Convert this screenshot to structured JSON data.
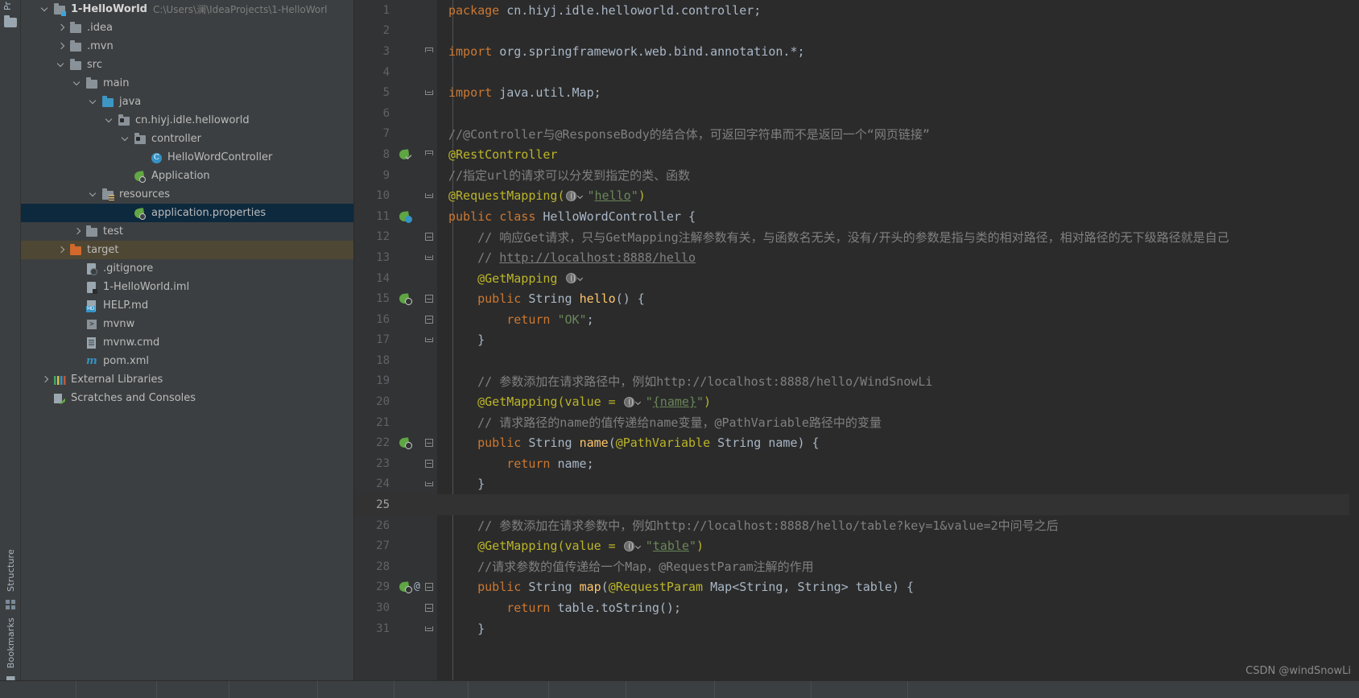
{
  "rail": {
    "top_label": "Pr",
    "project_icon": "folder-icon",
    "structure_label": "Structure",
    "bookmarks_label": "Bookmarks"
  },
  "project_tree": {
    "items": [
      {
        "label": "1-HelloWorld",
        "path": "C:\\Users\\澜\\IdeaProjects\\1-HelloWorl",
        "icon": "module-folder-icon",
        "indent": 0,
        "arrow": "open",
        "bold": true,
        "state": "normal"
      },
      {
        "label": ".idea",
        "path": "",
        "icon": "folder-icon",
        "indent": 1,
        "arrow": "closed",
        "bold": false,
        "state": "normal"
      },
      {
        "label": ".mvn",
        "path": "",
        "icon": "folder-icon",
        "indent": 1,
        "arrow": "closed",
        "bold": false,
        "state": "normal"
      },
      {
        "label": "src",
        "path": "",
        "icon": "folder-icon",
        "indent": 1,
        "arrow": "open",
        "bold": false,
        "state": "normal"
      },
      {
        "label": "main",
        "path": "",
        "icon": "folder-icon",
        "indent": 2,
        "arrow": "open",
        "bold": false,
        "state": "normal"
      },
      {
        "label": "java",
        "path": "",
        "icon": "source-folder-icon",
        "indent": 3,
        "arrow": "open",
        "bold": false,
        "state": "normal"
      },
      {
        "label": "cn.hiyj.idle.helloworld",
        "path": "",
        "icon": "package-icon",
        "indent": 4,
        "arrow": "open",
        "bold": false,
        "state": "normal"
      },
      {
        "label": "controller",
        "path": "",
        "icon": "package-icon",
        "indent": 5,
        "arrow": "open",
        "bold": false,
        "state": "normal"
      },
      {
        "label": "HelloWordController",
        "path": "",
        "icon": "java-class-icon",
        "indent": 6,
        "arrow": "none",
        "bold": false,
        "state": "normal"
      },
      {
        "label": "Application",
        "path": "",
        "icon": "spring-boot-class-icon",
        "indent": 5,
        "arrow": "none",
        "bold": false,
        "state": "normal"
      },
      {
        "label": "resources",
        "path": "",
        "icon": "resources-folder-icon",
        "indent": 3,
        "arrow": "open",
        "bold": false,
        "state": "normal"
      },
      {
        "label": "application.properties",
        "path": "",
        "icon": "spring-properties-icon",
        "indent": 5,
        "arrow": "none",
        "bold": false,
        "state": "selected"
      },
      {
        "label": "test",
        "path": "",
        "icon": "folder-icon",
        "indent": 2,
        "arrow": "closed",
        "bold": false,
        "state": "normal"
      },
      {
        "label": "target",
        "path": "",
        "icon": "excluded-folder-icon",
        "indent": 1,
        "arrow": "closed",
        "bold": false,
        "state": "excluded"
      },
      {
        "label": ".gitignore",
        "path": "",
        "icon": "gitignore-file-icon",
        "indent": 2,
        "arrow": "none",
        "bold": false,
        "state": "normal"
      },
      {
        "label": "1-HelloWorld.iml",
        "path": "",
        "icon": "iml-file-icon",
        "indent": 2,
        "arrow": "none",
        "bold": false,
        "state": "normal"
      },
      {
        "label": "HELP.md",
        "path": "",
        "icon": "markdown-file-icon",
        "indent": 2,
        "arrow": "none",
        "bold": false,
        "state": "normal"
      },
      {
        "label": "mvnw",
        "path": "",
        "icon": "shell-script-icon",
        "indent": 2,
        "arrow": "none",
        "bold": false,
        "state": "normal"
      },
      {
        "label": "mvnw.cmd",
        "path": "",
        "icon": "cmd-file-icon",
        "indent": 2,
        "arrow": "none",
        "bold": false,
        "state": "normal"
      },
      {
        "label": "pom.xml",
        "path": "",
        "icon": "maven-pom-icon",
        "indent": 2,
        "arrow": "none",
        "bold": false,
        "state": "normal"
      },
      {
        "label": "External Libraries",
        "path": "",
        "icon": "libraries-icon",
        "indent": 0,
        "arrow": "closed",
        "bold": false,
        "state": "normal"
      },
      {
        "label": "Scratches and Consoles",
        "path": "",
        "icon": "scratches-icon",
        "indent": 0,
        "arrow": "none",
        "bold": false,
        "state": "normal"
      }
    ]
  },
  "editor": {
    "caret_line": 25,
    "lines": [
      {
        "no": 1,
        "marker": "",
        "fold": "",
        "tokens": [
          {
            "t": "kw",
            "v": "package"
          },
          {
            "t": "plain",
            "v": " "
          },
          {
            "t": "cls",
            "v": "cn.hiyj.idle.helloworld.controller"
          },
          {
            "t": "punct",
            "v": ";"
          }
        ]
      },
      {
        "no": 2,
        "marker": "",
        "fold": "",
        "tokens": []
      },
      {
        "no": 3,
        "marker": "",
        "fold": "top-cap",
        "tokens": [
          {
            "t": "kw",
            "v": "import"
          },
          {
            "t": "plain",
            "v": " "
          },
          {
            "t": "cls",
            "v": "org.springframework.web.bind.annotation.*"
          },
          {
            "t": "punct",
            "v": ";"
          }
        ]
      },
      {
        "no": 4,
        "marker": "",
        "fold": "",
        "tokens": []
      },
      {
        "no": 5,
        "marker": "",
        "fold": "bot-cap",
        "tokens": [
          {
            "t": "kw",
            "v": "import"
          },
          {
            "t": "plain",
            "v": " "
          },
          {
            "t": "cls",
            "v": "java.util.Map"
          },
          {
            "t": "punct",
            "v": ";"
          }
        ]
      },
      {
        "no": 6,
        "marker": "",
        "fold": "",
        "tokens": []
      },
      {
        "no": 7,
        "marker": "",
        "fold": "",
        "tokens": [
          {
            "t": "cmt",
            "v": "//@Controller与@ResponseBody的结合体，可返回字符串而不是返回一个“网页链接”"
          }
        ]
      },
      {
        "no": 8,
        "marker": "spring-check",
        "fold": "top-cap",
        "tokens": [
          {
            "t": "ann",
            "v": "@RestController"
          }
        ]
      },
      {
        "no": 9,
        "marker": "",
        "fold": "",
        "tokens": [
          {
            "t": "cmt",
            "v": "//指定url的请求可以分发到指定的类、函数"
          }
        ]
      },
      {
        "no": 10,
        "marker": "",
        "fold": "bot-cap",
        "tokens": [
          {
            "t": "ann",
            "v": "@RequestMapping("
          },
          {
            "t": "urlicon",
            "v": ""
          },
          {
            "t": "str",
            "v": "\""
          },
          {
            "t": "link",
            "v": "hello"
          },
          {
            "t": "str",
            "v": "\""
          },
          {
            "t": "ann",
            "v": ")"
          }
        ]
      },
      {
        "no": 11,
        "marker": "spring-blue",
        "fold": "",
        "tokens": [
          {
            "t": "kw",
            "v": "public"
          },
          {
            "t": "plain",
            "v": " "
          },
          {
            "t": "kw",
            "v": "class"
          },
          {
            "t": "plain",
            "v": " "
          },
          {
            "t": "cls",
            "v": "HelloWordController"
          },
          {
            "t": "plain",
            "v": " "
          },
          {
            "t": "punct",
            "v": "{"
          }
        ]
      },
      {
        "no": 12,
        "marker": "",
        "fold": "box",
        "tokens": [
          {
            "t": "indent",
            "v": "    "
          },
          {
            "t": "cmt",
            "v": "// 响应Get请求，只与GetMapping注解参数有关，与函数名无关，没有/开头的参数是指与类的相对路径，相对路径的无下级路径就是自己"
          }
        ]
      },
      {
        "no": 13,
        "marker": "",
        "fold": "bot-cap",
        "tokens": [
          {
            "t": "indent",
            "v": "    "
          },
          {
            "t": "cmt",
            "v": "// "
          },
          {
            "t": "cmtlink",
            "v": "http://localhost:8888/hello"
          }
        ]
      },
      {
        "no": 14,
        "marker": "",
        "fold": "",
        "tokens": [
          {
            "t": "indent",
            "v": "    "
          },
          {
            "t": "ann",
            "v": "@GetMapping"
          },
          {
            "t": "plain",
            "v": " "
          },
          {
            "t": "urlicon",
            "v": ""
          }
        ]
      },
      {
        "no": 15,
        "marker": "spring",
        "fold": "box",
        "tokens": [
          {
            "t": "indent",
            "v": "    "
          },
          {
            "t": "kw",
            "v": "public"
          },
          {
            "t": "plain",
            "v": " "
          },
          {
            "t": "cls",
            "v": "String"
          },
          {
            "t": "plain",
            "v": " "
          },
          {
            "t": "fn",
            "v": "hello"
          },
          {
            "t": "punct",
            "v": "() {"
          }
        ]
      },
      {
        "no": 16,
        "marker": "",
        "fold": "box",
        "tokens": [
          {
            "t": "indent",
            "v": "        "
          },
          {
            "t": "kw",
            "v": "return"
          },
          {
            "t": "plain",
            "v": " "
          },
          {
            "t": "str",
            "v": "\"OK\""
          },
          {
            "t": "punct",
            "v": ";"
          }
        ]
      },
      {
        "no": 17,
        "marker": "",
        "fold": "bot-cap",
        "tokens": [
          {
            "t": "indent",
            "v": "    "
          },
          {
            "t": "punct",
            "v": "}"
          }
        ]
      },
      {
        "no": 18,
        "marker": "",
        "fold": "",
        "tokens": []
      },
      {
        "no": 19,
        "marker": "",
        "fold": "",
        "tokens": [
          {
            "t": "indent",
            "v": "    "
          },
          {
            "t": "cmt",
            "v": "// 参数添加在请求路径中，例如http://localhost:8888/hello/WindSnowLi"
          }
        ]
      },
      {
        "no": 20,
        "marker": "",
        "fold": "",
        "tokens": [
          {
            "t": "indent",
            "v": "    "
          },
          {
            "t": "ann",
            "v": "@GetMapping(value = "
          },
          {
            "t": "urlicon",
            "v": ""
          },
          {
            "t": "str",
            "v": "\""
          },
          {
            "t": "link",
            "v": "{name}"
          },
          {
            "t": "str",
            "v": "\""
          },
          {
            "t": "ann",
            "v": ")"
          }
        ]
      },
      {
        "no": 21,
        "marker": "",
        "fold": "",
        "tokens": [
          {
            "t": "indent",
            "v": "    "
          },
          {
            "t": "cmt",
            "v": "// 请求路径的name的值传递给name变量，@PathVariable路径中的变量"
          }
        ]
      },
      {
        "no": 22,
        "marker": "spring",
        "fold": "box",
        "tokens": [
          {
            "t": "indent",
            "v": "    "
          },
          {
            "t": "kw",
            "v": "public"
          },
          {
            "t": "plain",
            "v": " "
          },
          {
            "t": "cls",
            "v": "String"
          },
          {
            "t": "plain",
            "v": " "
          },
          {
            "t": "fn",
            "v": "name"
          },
          {
            "t": "punct",
            "v": "("
          },
          {
            "t": "ann",
            "v": "@PathVariable"
          },
          {
            "t": "plain",
            "v": " "
          },
          {
            "t": "cls",
            "v": "String"
          },
          {
            "t": "plain",
            "v": " "
          },
          {
            "t": "punct",
            "v": "name) {"
          }
        ]
      },
      {
        "no": 23,
        "marker": "",
        "fold": "box",
        "tokens": [
          {
            "t": "indent",
            "v": "        "
          },
          {
            "t": "kw",
            "v": "return"
          },
          {
            "t": "plain",
            "v": " "
          },
          {
            "t": "punct",
            "v": "name;"
          }
        ]
      },
      {
        "no": 24,
        "marker": "",
        "fold": "bot-cap",
        "tokens": [
          {
            "t": "indent",
            "v": "    "
          },
          {
            "t": "punct",
            "v": "}"
          }
        ]
      },
      {
        "no": 25,
        "marker": "",
        "fold": "",
        "tokens": []
      },
      {
        "no": 26,
        "marker": "",
        "fold": "",
        "tokens": [
          {
            "t": "indent",
            "v": "    "
          },
          {
            "t": "cmt",
            "v": "// 参数添加在请求参数中，例如http://localhost:8888/hello/table?key=1&value=2中问号之后"
          }
        ]
      },
      {
        "no": 27,
        "marker": "",
        "fold": "",
        "tokens": [
          {
            "t": "indent",
            "v": "    "
          },
          {
            "t": "ann",
            "v": "@GetMapping(value = "
          },
          {
            "t": "urlicon",
            "v": ""
          },
          {
            "t": "str",
            "v": "\""
          },
          {
            "t": "link",
            "v": "table"
          },
          {
            "t": "str",
            "v": "\""
          },
          {
            "t": "ann",
            "v": ")"
          }
        ]
      },
      {
        "no": 28,
        "marker": "",
        "fold": "",
        "tokens": [
          {
            "t": "indent",
            "v": "    "
          },
          {
            "t": "cmt",
            "v": "//请求参数的值传递给一个Map，@RequestParam注解的作用"
          }
        ]
      },
      {
        "no": 29,
        "marker": "spring-at",
        "fold": "box",
        "tokens": [
          {
            "t": "indent",
            "v": "    "
          },
          {
            "t": "kw",
            "v": "public"
          },
          {
            "t": "plain",
            "v": " "
          },
          {
            "t": "cls",
            "v": "String"
          },
          {
            "t": "plain",
            "v": " "
          },
          {
            "t": "fn",
            "v": "map"
          },
          {
            "t": "punct",
            "v": "("
          },
          {
            "t": "ann",
            "v": "@RequestParam"
          },
          {
            "t": "plain",
            "v": " "
          },
          {
            "t": "cls",
            "v": "Map"
          },
          {
            "t": "punct",
            "v": "<"
          },
          {
            "t": "cls",
            "v": "String"
          },
          {
            "t": "punct",
            "v": ", "
          },
          {
            "t": "cls",
            "v": "String"
          },
          {
            "t": "punct",
            "v": "> table) {"
          }
        ]
      },
      {
        "no": 30,
        "marker": "",
        "fold": "box",
        "tokens": [
          {
            "t": "indent",
            "v": "        "
          },
          {
            "t": "kw",
            "v": "return"
          },
          {
            "t": "plain",
            "v": " "
          },
          {
            "t": "punct",
            "v": "table.toString();"
          }
        ]
      },
      {
        "no": 31,
        "marker": "",
        "fold": "bot-cap",
        "tokens": [
          {
            "t": "indent",
            "v": "    "
          },
          {
            "t": "punct",
            "v": "}"
          }
        ]
      }
    ]
  },
  "watermark": {
    "text": "CSDN @windSnowLi"
  },
  "colors": {
    "editor_bg": "#2b2b2b",
    "panel_bg": "#3c3f41",
    "gutter_bg": "#313335",
    "selection_bg": "#0d293e",
    "excluded_bg": "#4e4733",
    "keyword": "#cc7832",
    "string": "#6a8759",
    "comment": "#808080",
    "annotation": "#bbb529",
    "method": "#ffc66d",
    "default_text": "#a9b7c6"
  }
}
